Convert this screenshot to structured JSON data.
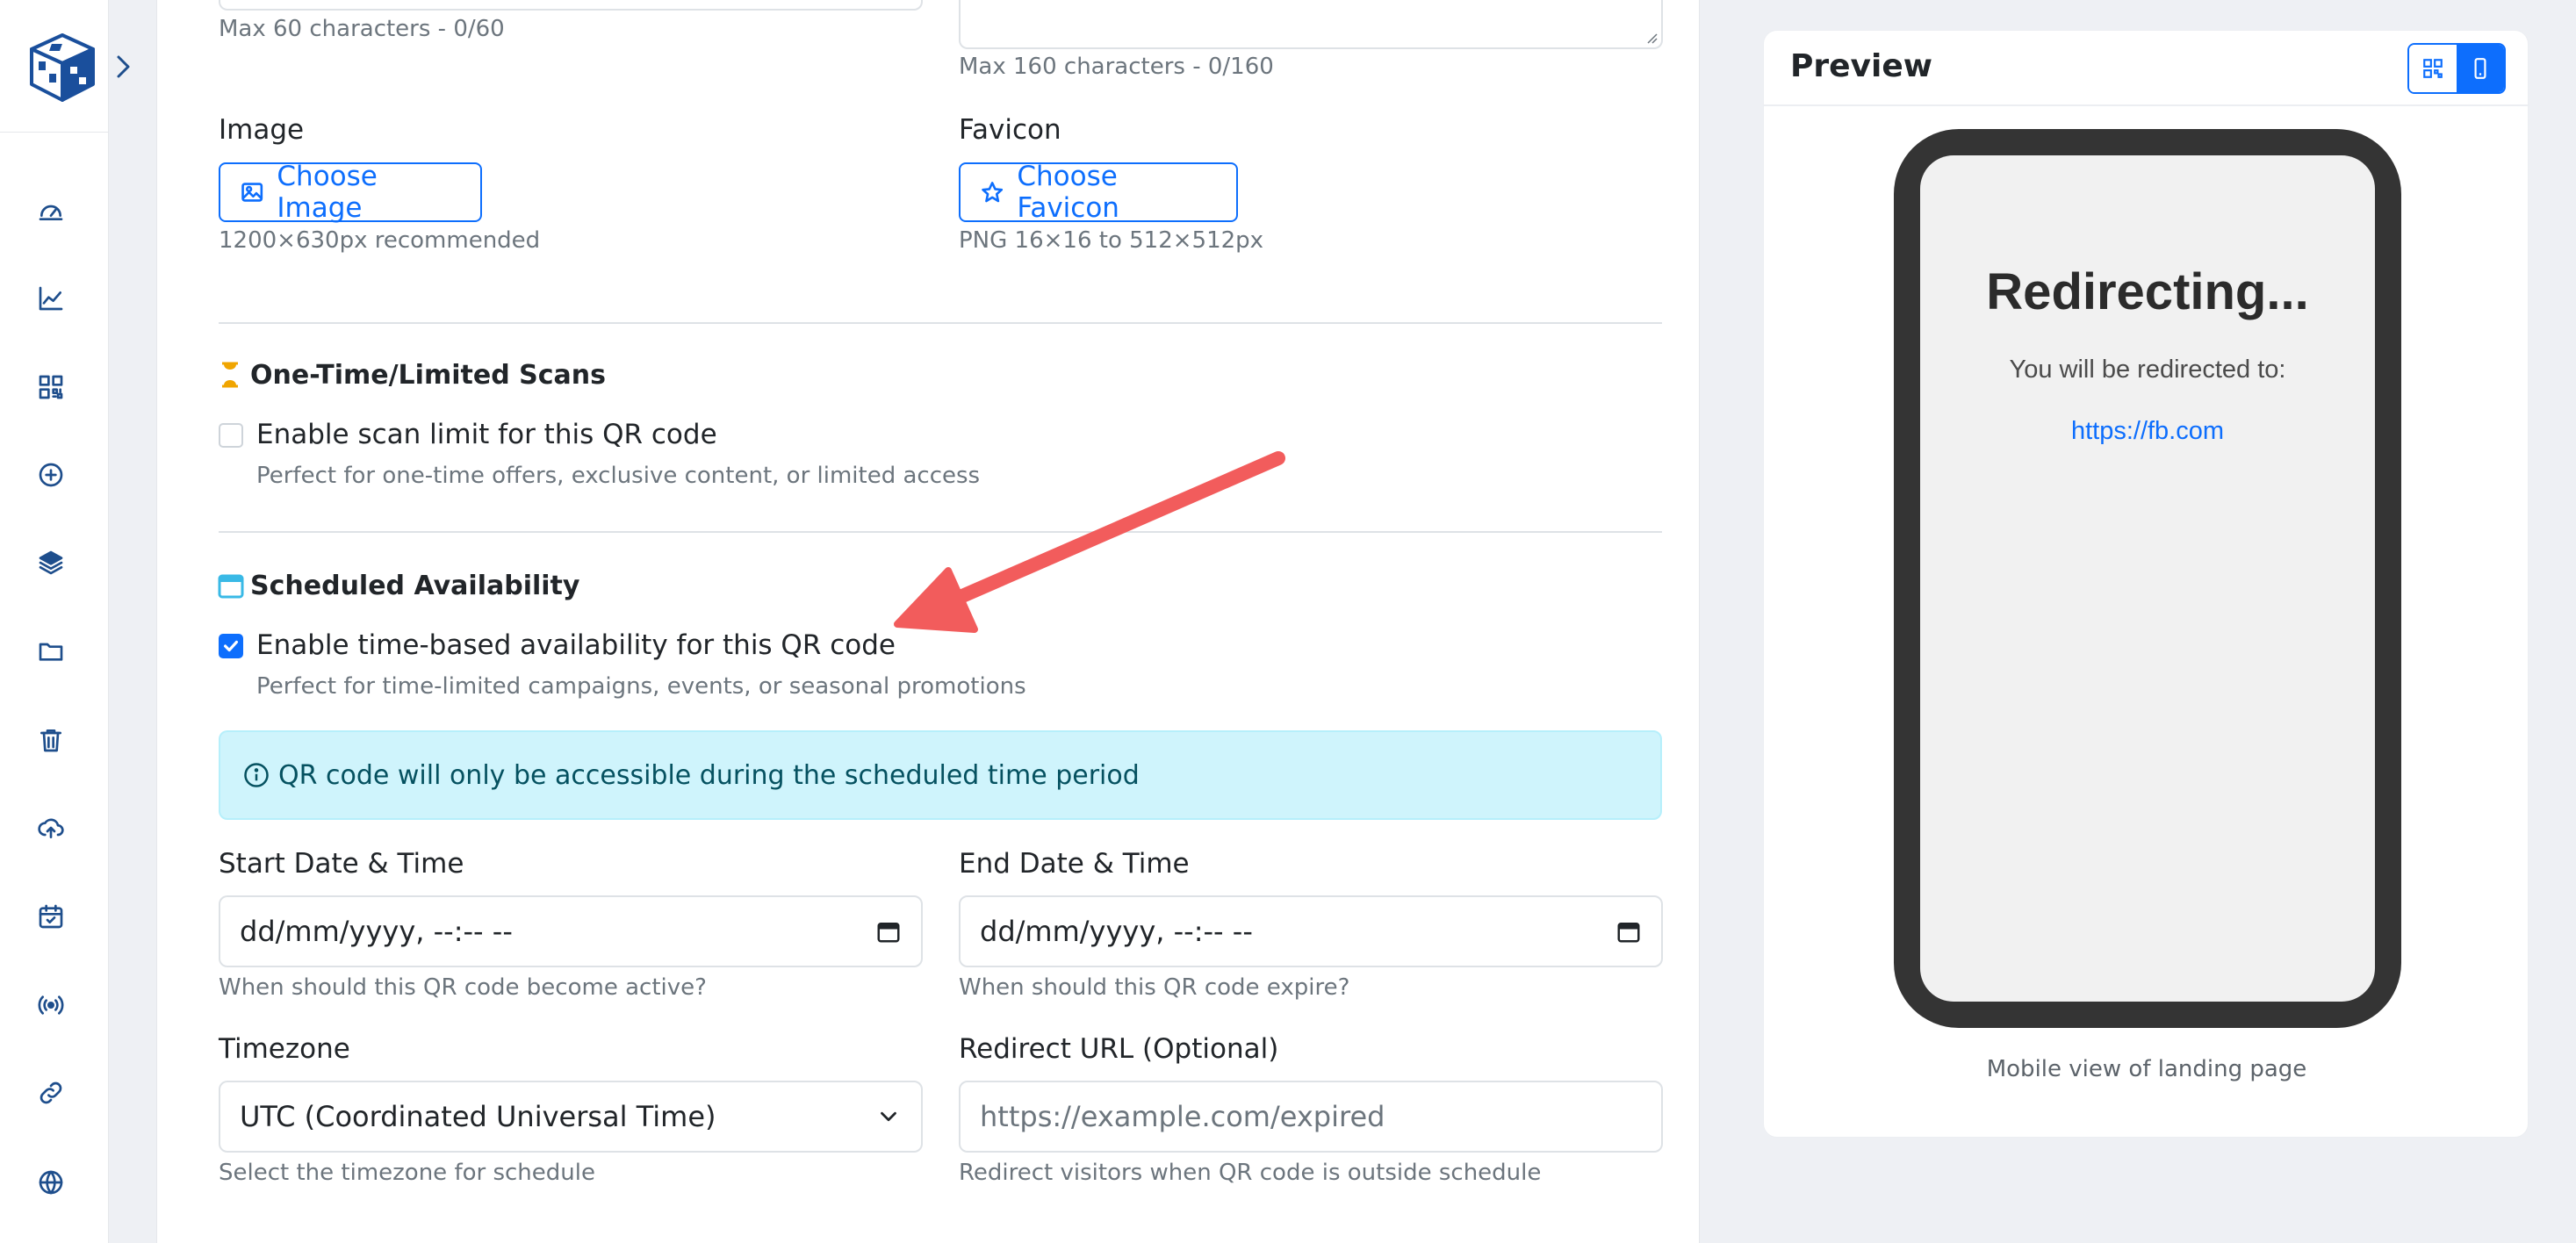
{
  "form": {
    "title_counter": "Max 60 characters - 0/60",
    "description_counter": "Max 160 characters - 0/160",
    "image_label": "Image",
    "image_button": "Choose Image",
    "image_hint": "1200×630px recommended",
    "favicon_label": "Favicon",
    "favicon_button": "Choose Favicon",
    "favicon_hint": "PNG 16×16 to 512×512px"
  },
  "limited_scans": {
    "icon": "hourglass-icon",
    "title": "One-Time/Limited Scans",
    "checkbox_label": "Enable scan limit for this QR code",
    "checked": false,
    "help": "Perfect for one-time offers, exclusive content, or limited access"
  },
  "scheduled": {
    "icon": "calendar-icon",
    "title": "Scheduled Availability",
    "checkbox_label": "Enable time-based availability for this QR code",
    "checked": true,
    "help": "Perfect for time-limited campaigns, events, or seasonal promotions",
    "alert": "QR code will only be accessible during the scheduled time period",
    "start_label": "Start Date & Time",
    "start_value": "dd/mm/yyyy, --:-- --",
    "start_hint": "When should this QR code become active?",
    "end_label": "End Date & Time",
    "end_value": "dd/mm/yyyy, --:-- --",
    "end_hint": "When should this QR code expire?",
    "timezone_label": "Timezone",
    "timezone_value": "UTC (Coordinated Universal Time)",
    "timezone_hint": "Select the timezone for schedule",
    "redirect_label": "Redirect URL (Optional)",
    "redirect_placeholder": "https://example.com/expired",
    "redirect_hint": "Redirect visitors when QR code is outside schedule"
  },
  "preview": {
    "title": "Preview",
    "phone_title": "Redirecting...",
    "phone_subtitle": "You will be redirected to:",
    "phone_link": "https://fb.com",
    "caption": "Mobile view of landing page"
  },
  "sidebar": {
    "items": [
      {
        "icon": "dashboard-icon"
      },
      {
        "icon": "analytics-icon"
      },
      {
        "icon": "qr-code-icon"
      },
      {
        "icon": "add-icon"
      },
      {
        "icon": "layers-icon"
      },
      {
        "icon": "folder-icon"
      },
      {
        "icon": "trash-icon"
      },
      {
        "icon": "cloud-upload-icon"
      },
      {
        "icon": "calendar-check-icon"
      },
      {
        "icon": "broadcast-icon"
      },
      {
        "icon": "link-icon"
      },
      {
        "icon": "globe-icon"
      }
    ]
  },
  "colors": {
    "primary": "#0d6efd",
    "info_bg": "#cff4fc",
    "info_text": "#055160",
    "annotation_arrow": "#f25c5c",
    "hourglass": "#f0a500",
    "calendar": "#39b9e6"
  }
}
